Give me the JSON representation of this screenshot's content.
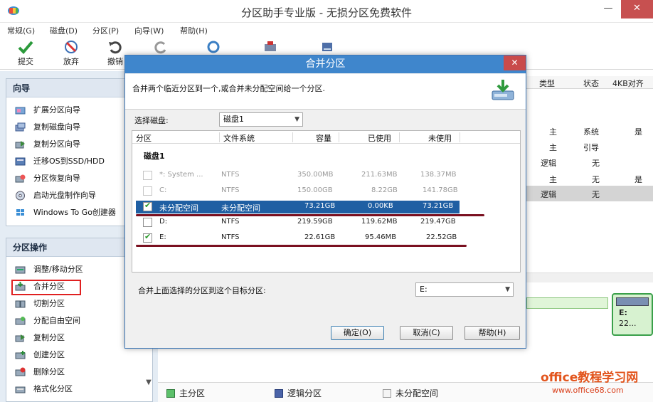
{
  "app": {
    "title": "分区助手专业版 - 无损分区免费软件",
    "min_glyph": "—",
    "close_glyph": "✕"
  },
  "menu": [
    "常规(G)",
    "磁盘(D)",
    "分区(P)",
    "向导(W)",
    "帮助(H)"
  ],
  "toolbar": {
    "commit": "提交",
    "discard": "放弃",
    "undo": "撤销"
  },
  "wizard": {
    "title": "向导",
    "items": [
      "扩展分区向导",
      "复制磁盘向导",
      "复制分区向导",
      "迁移OS到SSD/HDD",
      "分区恢复向导",
      "启动光盘制作向导",
      "Windows To Go创建器"
    ]
  },
  "partition_ops": {
    "title": "分区操作",
    "items": [
      "调整/移动分区",
      "合并分区",
      "切割分区",
      "分配自由空间",
      "复制分区",
      "创建分区",
      "删除分区",
      "格式化分区"
    ]
  },
  "right_table": {
    "headers": {
      "type": "类型",
      "status": "状态",
      "align": "4KB对齐"
    },
    "rows": [
      {
        "type": "主",
        "status": "系统",
        "align": "是"
      },
      {
        "type": "主",
        "status": "引导",
        "align": ""
      },
      {
        "type": "逻辑",
        "status": "无",
        "align": ""
      },
      {
        "type": "主",
        "status": "无",
        "align": "是"
      },
      {
        "type": "逻辑",
        "status": "无",
        "align": ""
      }
    ],
    "disk_card": {
      "name": "E:",
      "size": "22..."
    }
  },
  "legend": {
    "primary": "主分区",
    "logical": "逻辑分区",
    "unallocated": "未分配空间"
  },
  "dialog": {
    "title": "合并分区",
    "close": "✕",
    "description": "合并两个临近分区到一个,或合并未分配空间给一个分区.",
    "select_disk_label": "选择磁盘:",
    "selected_disk": "磁盘1",
    "columns": {
      "partition": "分区",
      "fs": "文件系统",
      "capacity": "容量",
      "used": "已使用",
      "unused": "未使用"
    },
    "disk_label": "磁盘1",
    "rows": [
      {
        "name": "*: System ...",
        "fs": "NTFS",
        "capacity": "350.00MB",
        "used": "211.63MB",
        "unused": "138.37MB",
        "checked": false,
        "state": "disabled"
      },
      {
        "name": "C:",
        "fs": "NTFS",
        "capacity": "150.00GB",
        "used": "8.22GB",
        "unused": "141.78GB",
        "checked": false,
        "state": "disabled"
      },
      {
        "name": "未分配空间",
        "fs": "未分配空间",
        "capacity": "73.21GB",
        "used": "0.00KB",
        "unused": "73.21GB",
        "checked": true,
        "state": "selected"
      },
      {
        "name": "D:",
        "fs": "NTFS",
        "capacity": "219.59GB",
        "used": "119.62MB",
        "unused": "219.47GB",
        "checked": false,
        "state": "normal"
      },
      {
        "name": "E:",
        "fs": "NTFS",
        "capacity": "22.61GB",
        "used": "95.46MB",
        "unused": "22.52GB",
        "checked": true,
        "state": "normal"
      }
    ],
    "target_label": "合并上面选择的分区到这个目标分区:",
    "target_value": "E:",
    "buttons": {
      "ok": "确定(O)",
      "cancel": "取消(C)",
      "help": "帮助(H)"
    }
  },
  "watermark": {
    "line1": "office教程学习网",
    "line2": "www.office68.com"
  },
  "colors": {
    "accent": "#3f86cc",
    "selection": "#1f5fa3",
    "close_button": "#c75050",
    "annotation_red": "#e02020",
    "annotation_underline": "#7a1020"
  }
}
